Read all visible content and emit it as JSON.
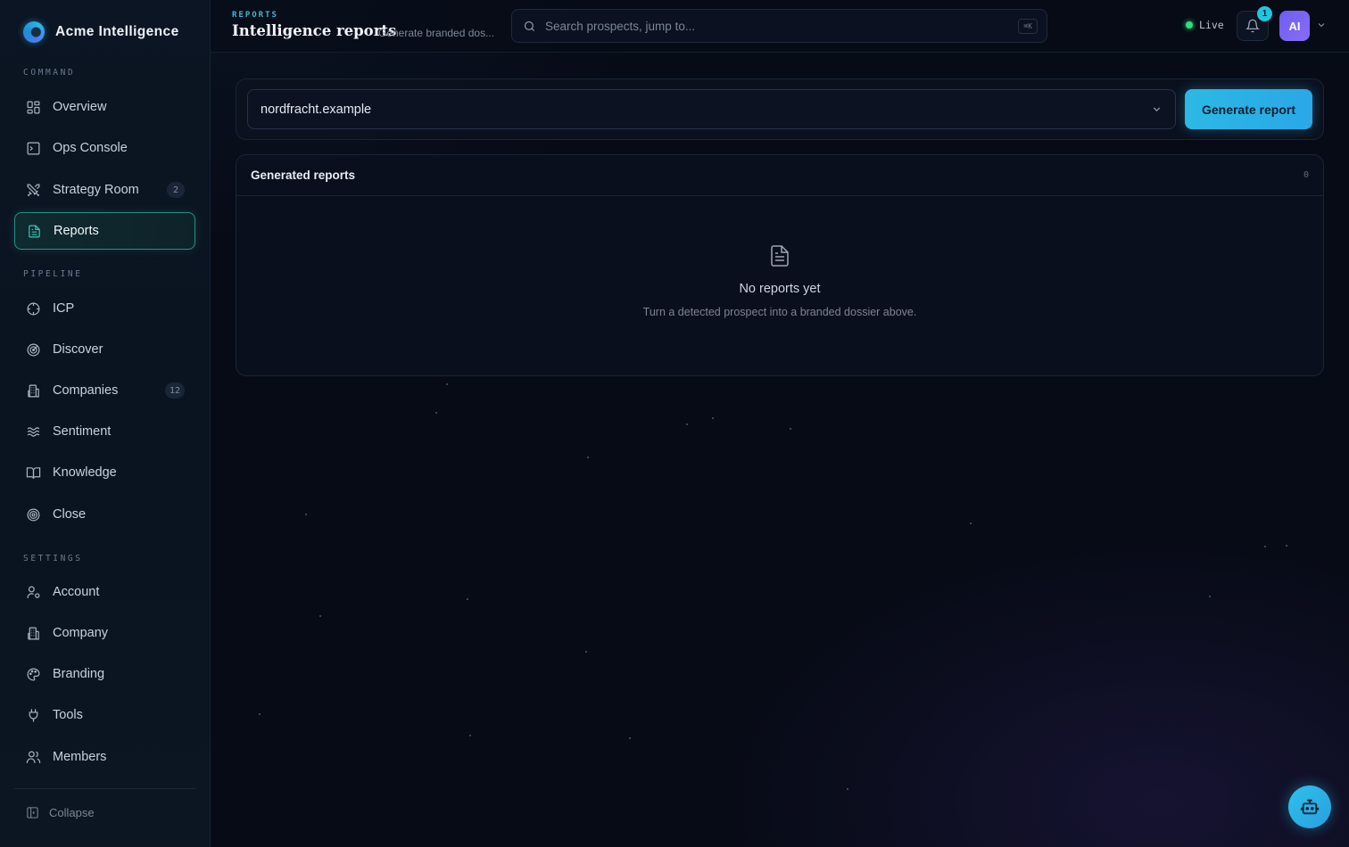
{
  "brand": {
    "name": "Acme Intelligence"
  },
  "sidebar": {
    "sections": {
      "command": "COMMAND",
      "pipeline": "PIPELINE",
      "settings": "SETTINGS"
    },
    "items": [
      {
        "label": "Overview",
        "icon": "grid-icon"
      },
      {
        "label": "Ops Console",
        "icon": "terminal-icon"
      },
      {
        "label": "Strategy Room",
        "icon": "swords-icon",
        "badge": "2"
      },
      {
        "label": "Reports",
        "icon": "document-icon",
        "active": true
      },
      {
        "label": "ICP",
        "icon": "crosshair-icon"
      },
      {
        "label": "Discover",
        "icon": "radar-icon"
      },
      {
        "label": "Companies",
        "icon": "building-icon",
        "badge": "12"
      },
      {
        "label": "Sentiment",
        "icon": "waves-icon"
      },
      {
        "label": "Knowledge",
        "icon": "book-icon"
      },
      {
        "label": "Close",
        "icon": "target-icon"
      },
      {
        "label": "Account",
        "icon": "user-gear-icon"
      },
      {
        "label": "Company",
        "icon": "building-icon"
      },
      {
        "label": "Branding",
        "icon": "palette-icon"
      },
      {
        "label": "Tools",
        "icon": "plug-icon"
      },
      {
        "label": "Members",
        "icon": "users-icon"
      }
    ],
    "collapse_label": "Collapse"
  },
  "header": {
    "eyebrow": "REPORTS",
    "title": "Intelligence reports",
    "subtitle": "Generate branded dos...",
    "search_placeholder": "Search prospects, jump to...",
    "search_shortcut": "⌘K",
    "live_label": "Live",
    "notification_count": "1",
    "avatar_initials": "AI"
  },
  "generator": {
    "selected_domain": "nordfracht.example",
    "button_label": "Generate report"
  },
  "reports": {
    "title": "Generated reports",
    "count": "0",
    "empty_title": "No reports yet",
    "empty_subtitle": "Turn a detected prospect into a branded dossier above."
  },
  "colors": {
    "accent": "#2bb9e3",
    "active_border": "#2a8e87",
    "live": "#2ee07d",
    "avatar": "#7a63f4"
  }
}
